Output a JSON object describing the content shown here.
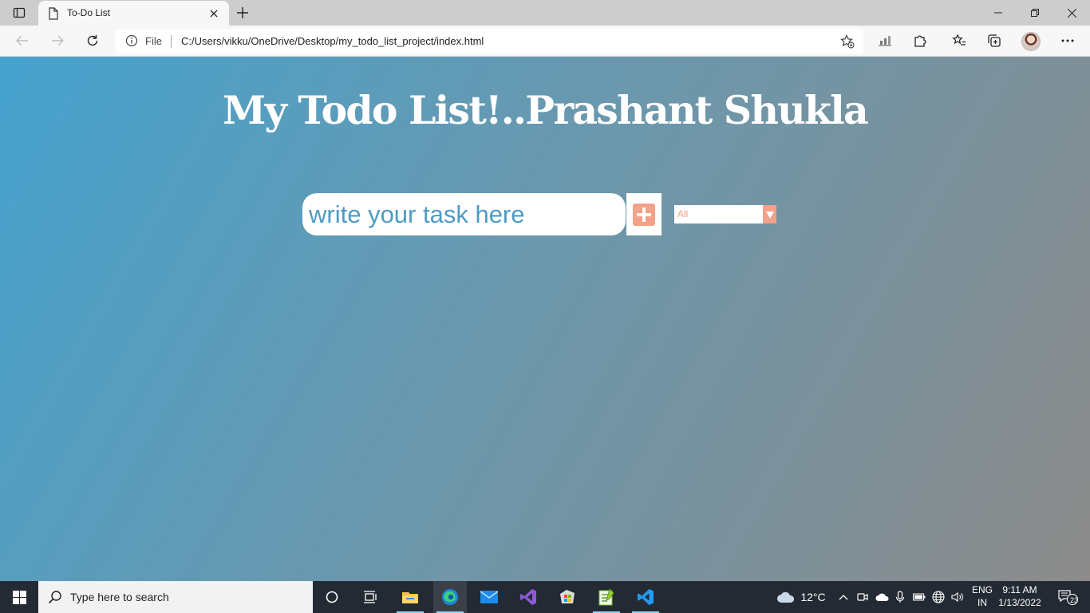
{
  "browser": {
    "tab_title": "To-Do List",
    "address_scheme_label": "File",
    "address_url": "C:/Users/vikku/OneDrive/Desktop/my_todo_list_project/index.html"
  },
  "page": {
    "heading": "My Todo List!..Prashant Shukla",
    "input_placeholder": "write your task here",
    "filter_selected": "All"
  },
  "taskbar": {
    "search_placeholder": "Type here to search",
    "weather_temp": "12°C",
    "language_top": "ENG",
    "language_bottom": "IN",
    "time": "9:11 AM",
    "date": "1/13/2022",
    "notification_count": "23"
  },
  "colors": {
    "accent_salmon": "#f3a188",
    "text_blue": "#4d9bc4",
    "gradient_start": "#45a3cf",
    "gradient_end": "#8d8b8a"
  }
}
